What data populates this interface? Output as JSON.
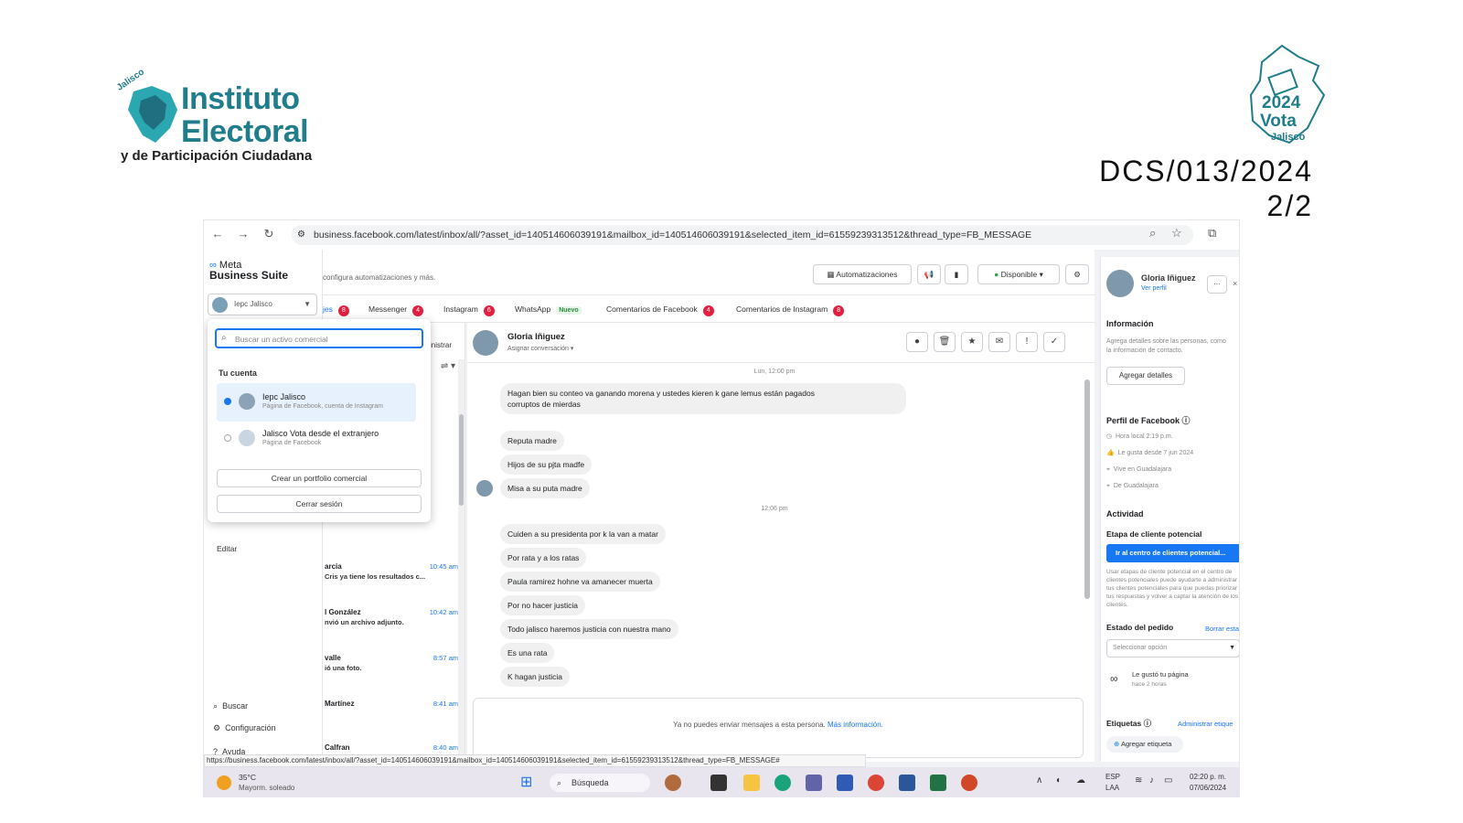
{
  "header": {
    "logo_main": "Instituto\nElectoral",
    "logo_sub": "y de Participación Ciudadana",
    "logo_tiny": "Jalisco",
    "vote_year": "2024",
    "vote_word": "Vota",
    "vote_state": "Jalisco",
    "doc_code": "DCS/013/2024",
    "page": "2/2"
  },
  "browser": {
    "url": "business.facebook.com/latest/inbox/all/?asset_id=140514606039191&mailbox_id=140514606039191&selected_item_id=61559239313512&thread_type=FB_MESSAGE",
    "status_url": "https://business.facebook.com/latest/inbox/all/?asset_id=140514606039191&mailbox_id=140514606039191&selected_item_id=61559239313512&thread_type=FB_MESSAGE#"
  },
  "app": {
    "brand_top": "Meta",
    "brand_bottom": "Business Suite",
    "account": "Iepc Jalisco",
    "hint": "configura automatizaciones y más.",
    "edit": "Editar",
    "search": "Buscar",
    "settings": "Configuración",
    "help": "Ayuda"
  },
  "dropdown": {
    "placeholder": "Buscar un activo comercial",
    "section": "Tu cuenta",
    "options": [
      {
        "name": "Iepc Jalisco",
        "sub": "Página de Facebook, cuenta de Instagram"
      },
      {
        "name": "Jalisco Vota desde el extranjero",
        "sub": "Página de Facebook"
      }
    ],
    "create": "Crear un portfolio comercial",
    "logout": "Cerrar sesión"
  },
  "toolbar": {
    "automations": "Automatizaciones",
    "available": "Disponible",
    "administrar": "inistrar"
  },
  "tabs": [
    {
      "label": "jes",
      "badge": "8"
    },
    {
      "label": "Messenger",
      "badge": "4"
    },
    {
      "label": "Instagram",
      "badge": "6"
    },
    {
      "label": "WhatsApp",
      "badge": "Nuevo"
    },
    {
      "label": "Comentarios de Facebook",
      "badge": "4"
    },
    {
      "label": "Comentarios de Instagram",
      "badge": "8"
    }
  ],
  "conversations": [
    {
      "name": "arcia",
      "preview": "Cris ya tiene los resultados c...",
      "time": "10:45 am"
    },
    {
      "name": "l González",
      "preview": "nvió un archivo adjunto.",
      "time": "10:42 am"
    },
    {
      "name": "valle",
      "preview": "ió una foto.",
      "time": "8:57 am"
    },
    {
      "name": "Martínez",
      "preview": "",
      "time": "8:41 am"
    },
    {
      "name": "Calfran",
      "preview": "",
      "time": "8:40 am"
    }
  ],
  "chat": {
    "contact": "Gloria Iñiguez",
    "assign": "Asignar conversación",
    "time1": "Lun, 12:00 pm",
    "time2": "12:06 pm",
    "messages": [
      "Hagan bien su conteo va ganando morena y ustedes kieren k gane lemus están pagados\ncorruptos de mierdas",
      "Reputa madre",
      "Hijos de su pjta madfe",
      "Misa a su puta madre",
      "Cuiden a su presidenta por k la van a matar",
      "Por rata y a los ratas",
      "Paula ramirez hohne va amanecer muerta",
      "Por no hacer justicia",
      "Todo jalisco haremos justicia con nuestra mano",
      "Es una rata",
      "K hagan justicia"
    ],
    "blocked": "Ya no puedes enviar mensajes a esta persona.",
    "more_info": "Más información."
  },
  "profile": {
    "name": "Gloria Iñiguez",
    "view": "Ver perfil",
    "info_h": "Información",
    "info_t": "Agrega detalles sobre las personas, como la información de contacto.",
    "add_details": "Agregar detalles",
    "fb_h": "Perfil de Facebook",
    "local": "Hora local 2:19 p.m.",
    "liked": "Le gusta desde 7 jun 2024",
    "lives": "Vive en Guadalajara",
    "from": "De Guadalajara",
    "activity_h": "Actividad",
    "stage_h": "Etapa de cliente potencial",
    "stage_btn": "Ir al centro de clientes potencial...",
    "stage_t": "Usar etapas de cliente potencial en el centro de clientes potenciales puede ayudarte a administrar tus clientes potenciales para que puedas priorizar tus respuestas y volver a captar la atención de los clientes.",
    "order_h": "Estado del pedido",
    "order_clear": "Borrar esta",
    "select": "Seleccionar opción",
    "liked_page": "Le gustó tu página",
    "liked_ago": "hace 2 horas",
    "tags_h": "Etiquetas",
    "tags_admin": "Administrar etique",
    "add_tag": "Agregar etiqueta"
  },
  "taskbar": {
    "temp": "35°C",
    "weather": "Mayorm. soleado",
    "search": "Búsqueda",
    "lang1": "ESP",
    "lang2": "LAA",
    "time": "02:20 p. m.",
    "date": "07/06/2024"
  }
}
